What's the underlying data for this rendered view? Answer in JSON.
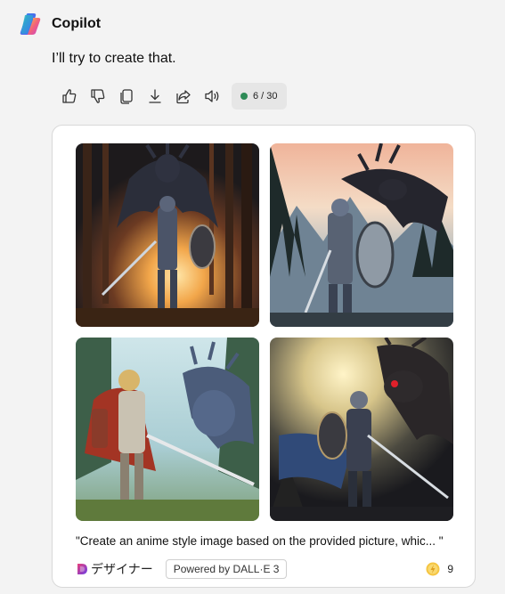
{
  "app": {
    "name": "Copilot"
  },
  "message": {
    "text": "I’ll try to create that."
  },
  "actions": {
    "icons": [
      "thumbs-up-icon",
      "thumbs-down-icon",
      "copy-icon",
      "download-icon",
      "share-icon",
      "speaker-icon"
    ],
    "counter": "6 / 30",
    "counter_dot_color": "#2e8b57"
  },
  "images": [
    {
      "description": "Armored knight with sword and shield facing dragon in forest at sunrise"
    },
    {
      "description": "Knight with round shield facing black dragon in misty mountains"
    },
    {
      "description": "Anime knight with red cape facing blue dragon in forest clearing"
    },
    {
      "description": "Dark knight with sword facing red-eyed dragon in dark forest"
    }
  ],
  "prompt": "\"Create an anime style image based on the provided picture, whic... \"",
  "footer": {
    "designer_label": "デザイナー",
    "powered_by": "Powered by DALL·E 3",
    "boost_count": "9"
  }
}
